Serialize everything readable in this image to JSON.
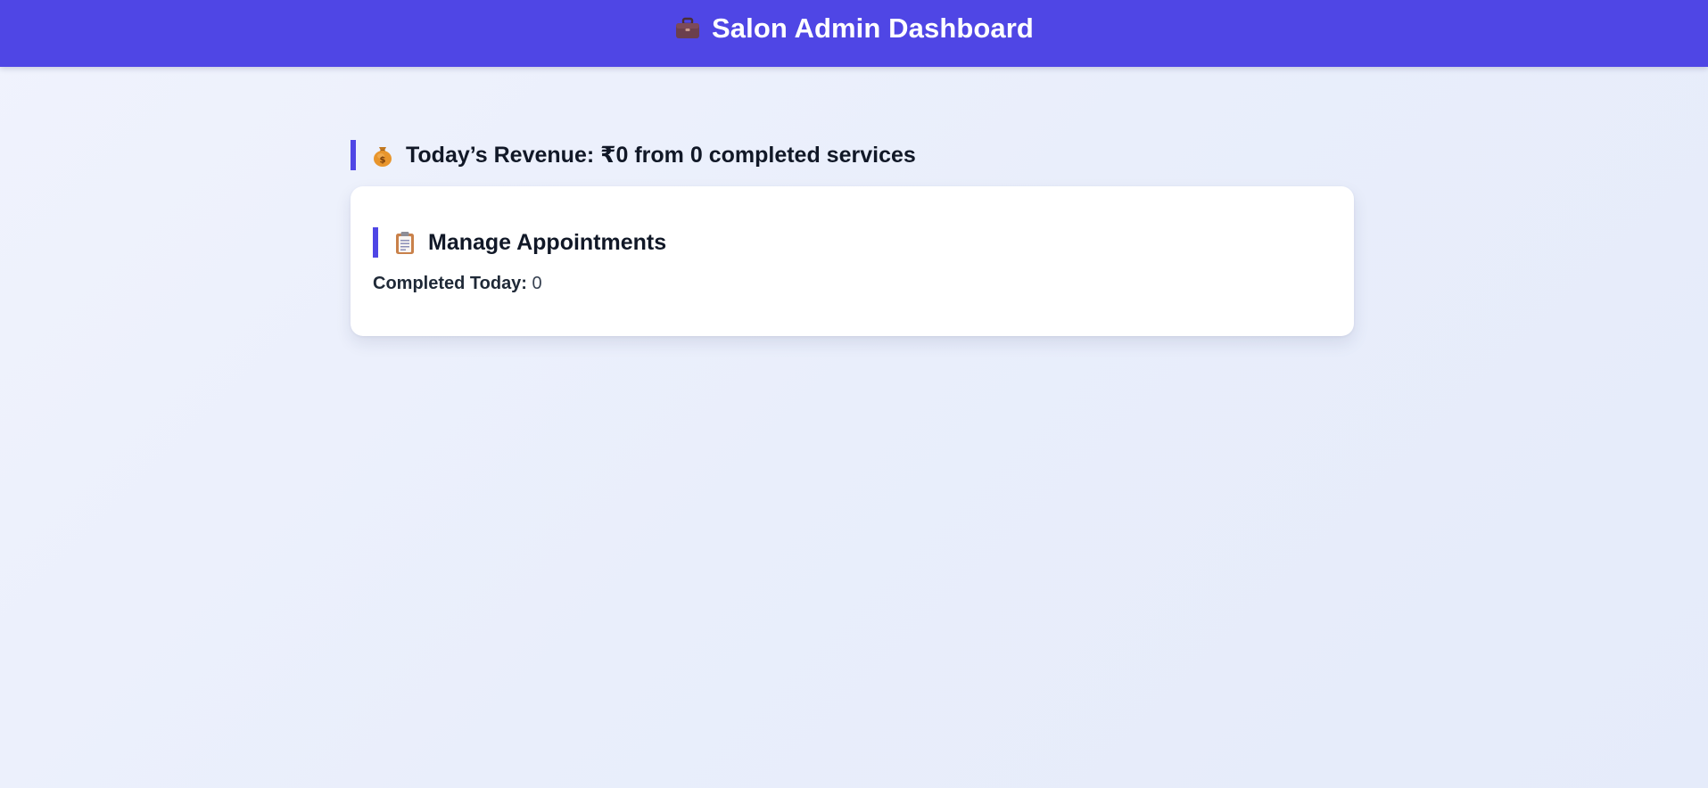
{
  "header": {
    "icon": "briefcase-icon",
    "title": "Salon Admin Dashboard",
    "background_color": "#4f46e5"
  },
  "revenue": {
    "icon": "money-bag-icon",
    "text": "Today’s Revenue: ₹0 from 0 completed services"
  },
  "appointments_card": {
    "icon": "clipboard-icon",
    "title": "Manage Appointments",
    "completed_label": "Completed Today:",
    "completed_value": "0"
  },
  "colors": {
    "accent": "#4f46e5",
    "background": "#eef2fc",
    "card": "#ffffff",
    "text": "#111827"
  }
}
